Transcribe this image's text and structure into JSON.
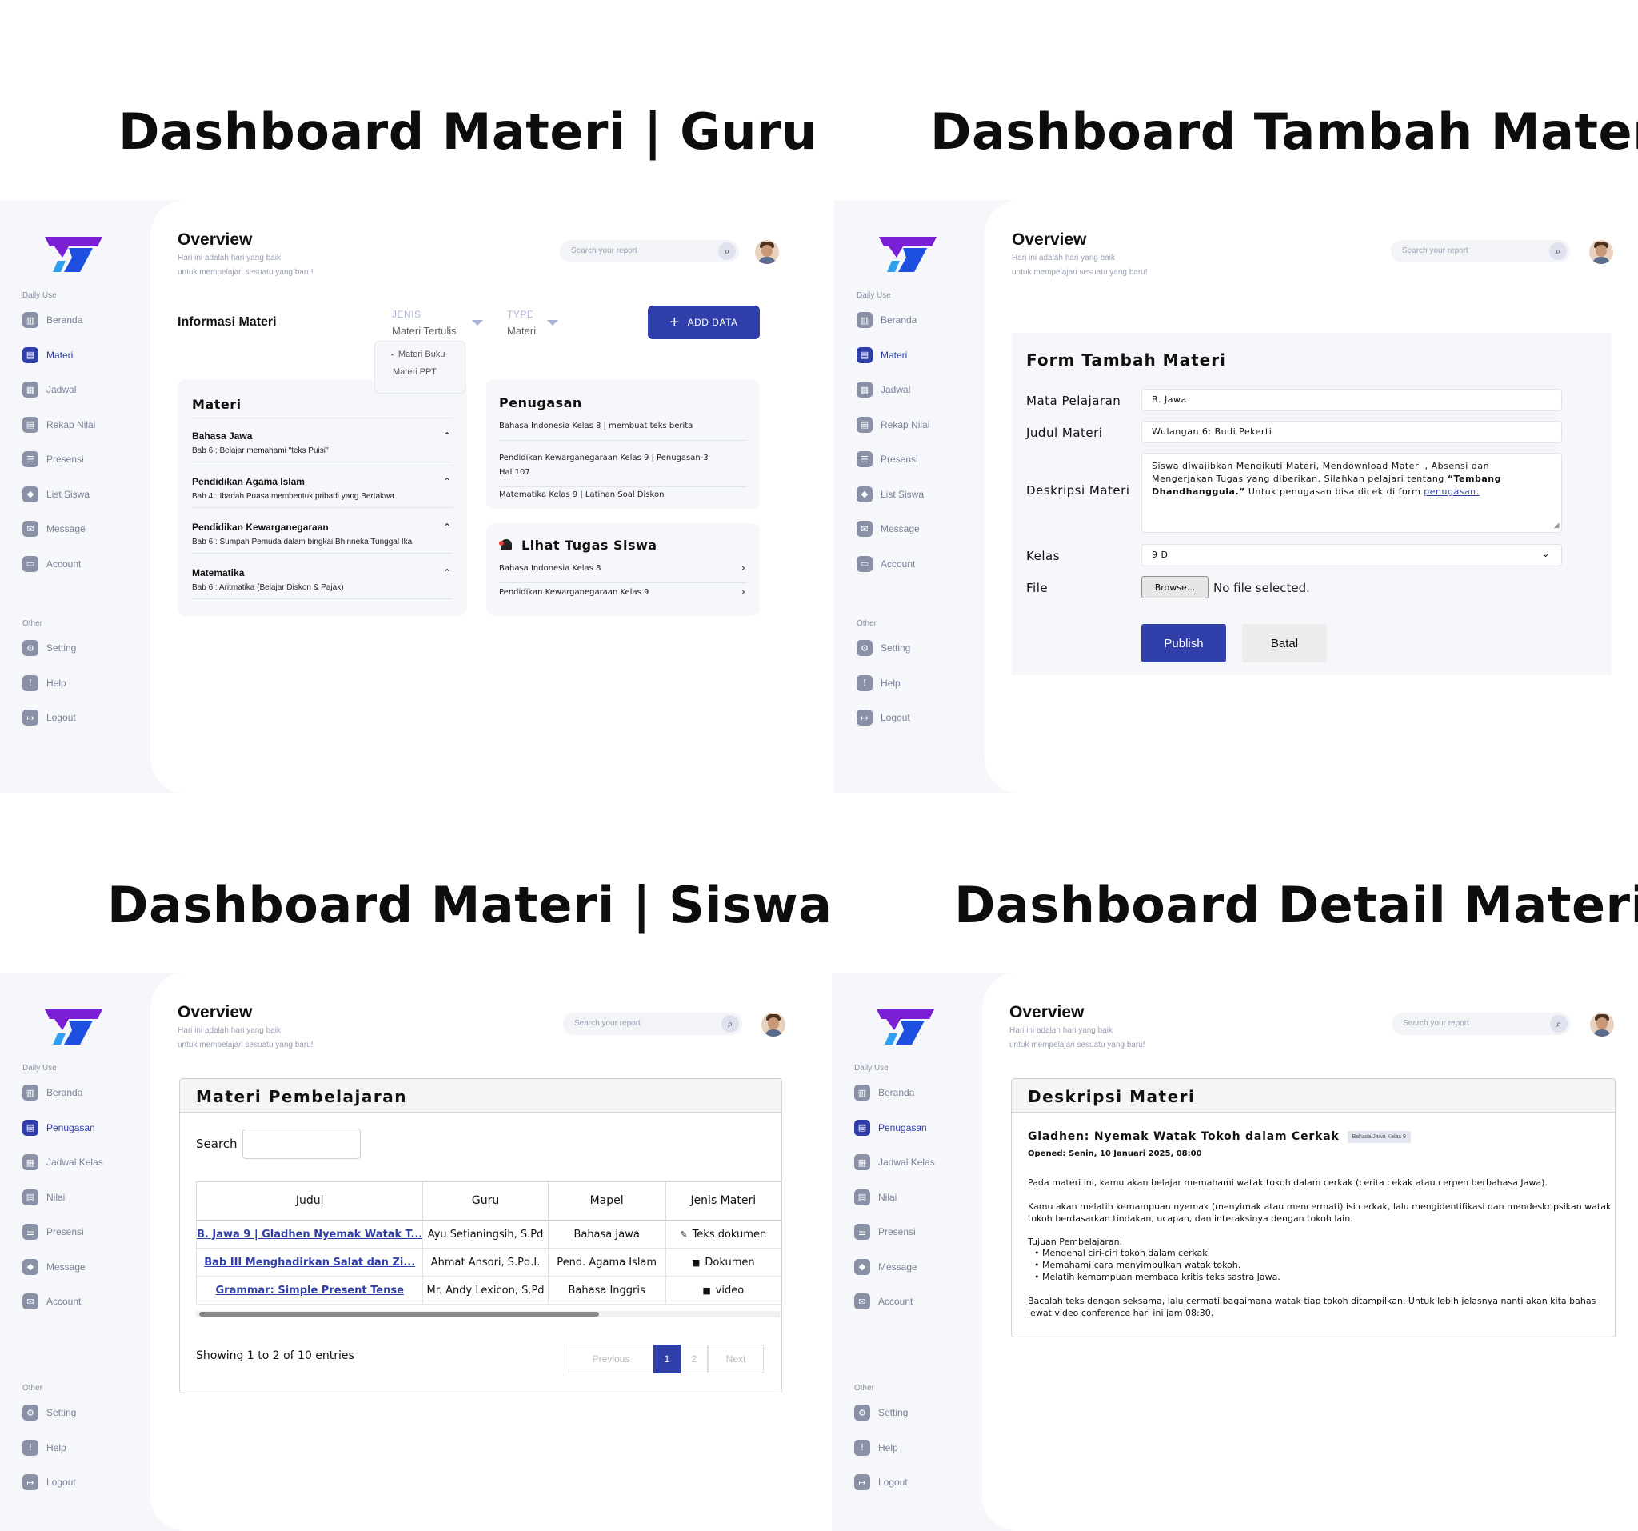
{
  "sections": {
    "guru_title": "Dashboard Materi | Guru",
    "tambah_title": "Dashboard Tambah Materi",
    "siswa_title": "Dashboard Materi | Siswa",
    "detail_title": "Dashboard Detail Materi"
  },
  "common": {
    "overview": "Overview",
    "subtitle_1": "Hari ini adalah hari yang baik",
    "subtitle_2": "untuk mempelajari sesuatu yang baru!",
    "search_placeholder": "Search your report",
    "daily_use": "Daily Use",
    "other": "Other",
    "other_items": [
      "Setting",
      "Help",
      "Logout"
    ]
  },
  "sidebar_guru": {
    "items": [
      "Beranda",
      "Materi",
      "Jadwal",
      "Rekap Nilai",
      "Presensi",
      "List Siswa",
      "Message",
      "Account"
    ],
    "active": "Materi"
  },
  "sidebar_siswa": {
    "items": [
      "Beranda",
      "Penugasan",
      "Jadwal Kelas",
      "Nilai",
      "Presensi",
      "Message",
      "Account"
    ],
    "active": "Penugasan"
  },
  "guru": {
    "info_title": "Informasi Materi",
    "jenis_label": "JENIS",
    "jenis_value": "Materi Tertulis",
    "type_label": "TYPE",
    "type_value": "Materi",
    "add_data": "ADD DATA",
    "menu_items": [
      "Materi Buku",
      "Materi PPT"
    ],
    "materi_title": "Materi",
    "materi_list": [
      {
        "title": "Bahasa Jawa",
        "sub": "Bab 6 : Belajar memahami \"teks Puisi\""
      },
      {
        "title": "Pendidikan Agama Islam",
        "sub": "Bab 4 : Ibadah Puasa membentuk pribadi yang Bertakwa"
      },
      {
        "title": "Pendidikan Kewarganegaraan",
        "sub": "Bab 6 : Sumpah Pemuda dalam bingkai Bhinneka Tunggal Ika"
      },
      {
        "title": "Matematika",
        "sub": "Bab 6 : Aritmatika (Belajar Diskon & Pajak)"
      }
    ],
    "penugasan_title": "Penugasan",
    "penugasan_list": [
      "Bahasa Indonesia Kelas 8 | membuat teks berita",
      "Pendidikan Kewarganegaraan Kelas 9 | Penugasan-3\nHal 107",
      "Matematika Kelas 9 | Latihan Soal Diskon"
    ],
    "tugas_title": "Lihat Tugas Siswa",
    "tugas_list": [
      "Bahasa Indonesia Kelas 8",
      "Pendidikan Kewarganegaraan Kelas 9"
    ]
  },
  "tambah": {
    "form_title": "Form Tambah Materi",
    "labels": {
      "mapel": "Mata Pelajaran",
      "judul": "Judul Materi",
      "deskripsi": "Deskripsi Materi",
      "kelas": "Kelas",
      "file": "File"
    },
    "mapel_value": "B. Jawa",
    "judul_value": "Wulangan 6: Budi Pekerti",
    "desc_part1": "Siswa diwajibkan Mengikuti Materi,  Mendownload Materi , Absensi dan Mengerjakan Tugas yang diberikan. Silahkan pelajari tentang ",
    "desc_bold": "“Tembang Dhandhanggula.”",
    "desc_part2": " Untuk penugasan bisa dicek di form ",
    "desc_link": "penugasan.",
    "kelas_value": "9 D",
    "browse": "Browse...",
    "no_file": "No file selected.",
    "publish": "Publish",
    "batal": "Batal"
  },
  "siswa": {
    "box_title": "Materi Pembelajaran",
    "search_label": "Search",
    "columns": [
      "Judul",
      "Guru",
      "Mapel",
      "Jenis Materi"
    ],
    "rows": [
      {
        "judul": "B. Jawa 9 | Gladhen Nyemak Watak T...",
        "guru": "Ayu Setianingsih, S.Pd",
        "mapel": "Bahasa Jawa",
        "jenis": "Teks dokumen"
      },
      {
        "judul": "Bab III Menghadirkan Salat dan Zi...",
        "guru": "Ahmat Ansori, S.Pd.I.",
        "mapel": "Pend. Agama Islam",
        "jenis": "Dokumen"
      },
      {
        "judul": "Grammar: Simple Present Tense",
        "guru": "Mr. Andy Lexicon, S.Pd",
        "mapel": "Bahasa Inggris",
        "jenis": "video"
      }
    ],
    "showing": "Showing 1 to 2 of 10 entries",
    "prev": "Previous",
    "page1": "1",
    "page2": "2",
    "next": "Next"
  },
  "detail": {
    "box_title": "Deskripsi Materi",
    "heading": "Gladhen: Nyemak Watak Tokoh dalam Cerkak",
    "badge": "Bahasa Jawa Kelas 9",
    "opened": "Opened: Senin, 10 Januari 2025, 08:00",
    "p1": "Pada materi ini, kamu akan belajar memahami watak tokoh dalam cerkak (cerita cekak atau cerpen berbahasa Jawa).",
    "p2": "Kamu akan melatih kemampuan nyemak (menyimak atau mencermati) isi cerkak, lalu mengidentifikasi dan mendeskripsikan watak tokoh berdasarkan tindakan, ucapan, dan interaksinya dengan tokoh lain.",
    "tujuan_title": "Tujuan Pembelajaran:",
    "tujuan": [
      "Mengenal ciri-ciri tokoh dalam cerkak.",
      "Memahami cara menyimpulkan watak tokoh.",
      "Melatih kemampuan membaca kritis teks sastra Jawa."
    ],
    "p3": "Bacalah teks dengan seksama, lalu cermati bagaimana watak tiap tokoh ditampilkan. Untuk lebih jelasnya nanti akan kita bahas lewat video conference hari ini jam 08:30."
  },
  "colors": {
    "accent": "#2f3ea8",
    "logo_purple": "#7a1fd6",
    "logo_blue": "#1d4fe0"
  }
}
